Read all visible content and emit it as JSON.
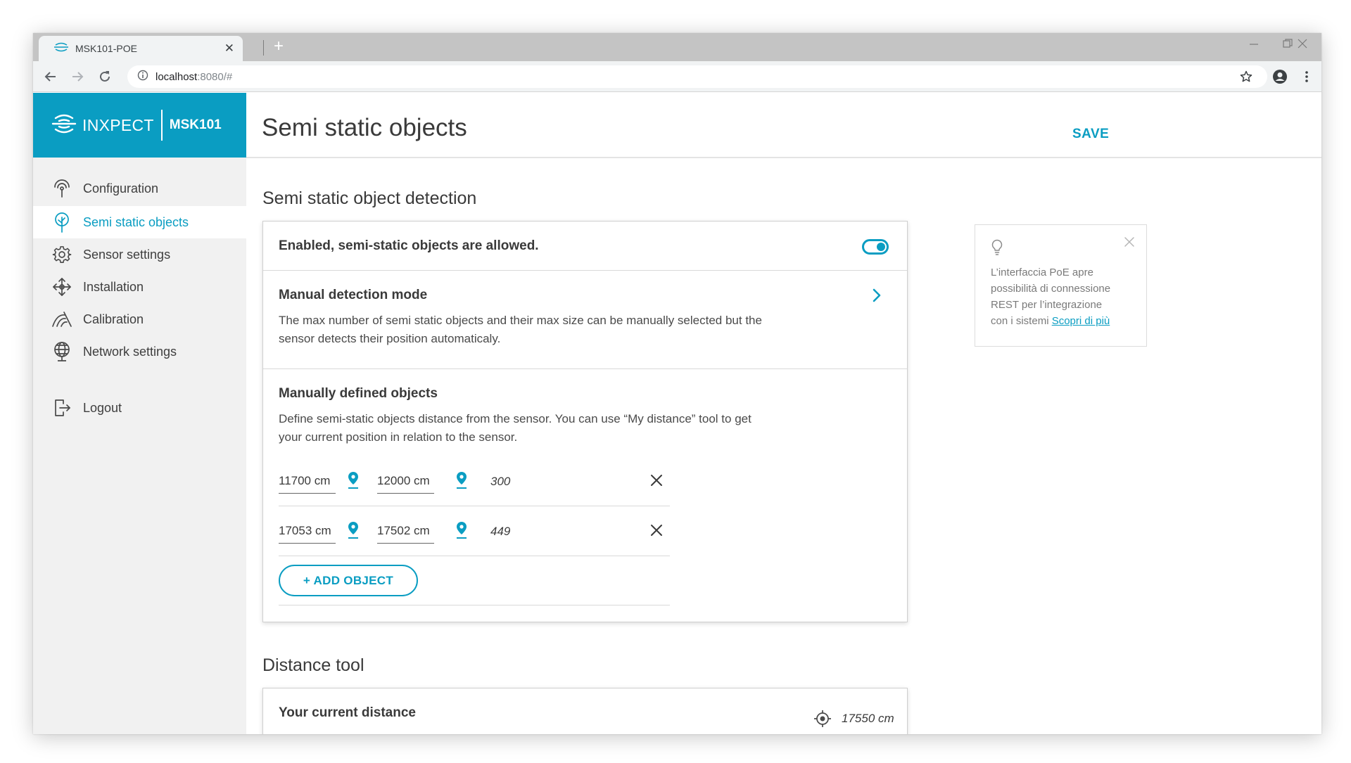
{
  "browser": {
    "tab_title": "MSK101-POE",
    "tab_close": "✕",
    "new_tab": "+",
    "url_host": "localhost",
    "url_rest": ":8080/#"
  },
  "brand": {
    "name": "INXPECT",
    "model": "MSK101"
  },
  "sidebar": {
    "items": [
      {
        "label": "Configuration",
        "icon": "antenna-icon"
      },
      {
        "label": "Semi static objects",
        "icon": "tree-icon",
        "active": true
      },
      {
        "label": "Sensor settings",
        "icon": "gear-icon"
      },
      {
        "label": "Installation",
        "icon": "move-arrows-icon"
      },
      {
        "label": "Calibration",
        "icon": "calibration-icon"
      },
      {
        "label": "Network settings",
        "icon": "globe-icon"
      }
    ],
    "logout": {
      "label": "Logout",
      "icon": "logout-icon"
    }
  },
  "header": {
    "title": "Semi static objects",
    "save_label": "SAVE"
  },
  "detection": {
    "section_title": "Semi static object detection",
    "enabled_label": "Enabled, semi-static objects are allowed.",
    "enabled": true,
    "manual_mode": {
      "title": "Manual detection mode",
      "description_line1": "The max number of semi static objects and their max size can be manually selected but the",
      "description_line2": "sensor detects their position automaticaly."
    },
    "manual_objects": {
      "title": "Manually defined objects",
      "description_line1": "Define semi-static objects distance from the sensor. You can use “My distance” tool to get",
      "description_line2": "your current position in relation to the sensor.",
      "rows": [
        {
          "start": "11700 cm",
          "end": "12000 cm",
          "size": "300"
        },
        {
          "start": "17053 cm",
          "end": "17502 cm",
          "size": "449"
        }
      ],
      "add_label": "+ ADD OBJECT"
    }
  },
  "distance_tool": {
    "section_title": "Distance tool",
    "current_label": "Your current distance",
    "current_value": "17550 cm"
  },
  "tip": {
    "line1": "L’interfaccia PoE apre",
    "line2": "possibilità di connessione",
    "line3": "REST per l’integrazione",
    "line4_prefix": "con i sistemi ",
    "link": "Scopri di più"
  },
  "colors": {
    "accent": "#0a9dc2",
    "sidebar_bg": "#f1f1f1",
    "text": "#3a3a3a"
  }
}
